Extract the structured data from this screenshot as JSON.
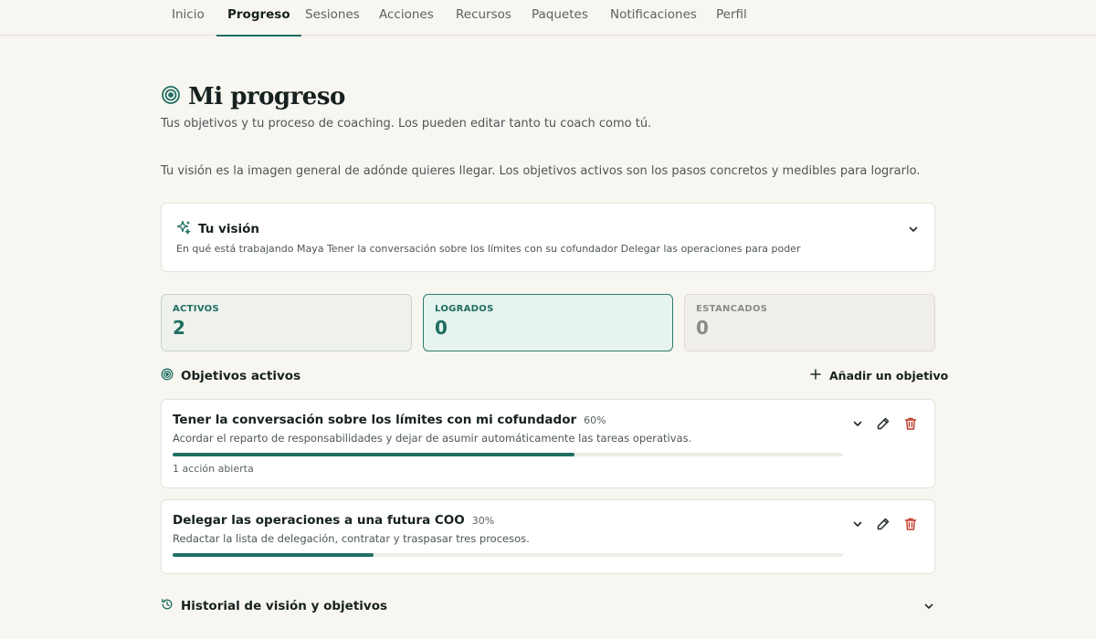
{
  "nav": {
    "tabs": [
      {
        "label": "Inicio"
      },
      {
        "label": "Progreso"
      },
      {
        "label": "Sesiones"
      },
      {
        "label": "Acciones"
      },
      {
        "label": "Recursos"
      },
      {
        "label": "Paquetes"
      },
      {
        "label": "Notificaciones"
      },
      {
        "label": "Perfil"
      }
    ],
    "active_index": 1
  },
  "header": {
    "title": "Mi progreso",
    "icon": "target-icon",
    "subtitle": "Tus objetivos y tu proceso de coaching. Los pueden editar tanto tu coach como tú.",
    "intro": "Tu visión es la imagen general de adónde quieres llegar. Los objetivos activos son los pasos concretos y medibles para lograrlo."
  },
  "vision": {
    "title": "Tu visión",
    "icon": "sparkles-icon",
    "text": "En qué está trabajando Maya Tener la conversación sobre los límites con su cofundador Delegar las operaciones para poder"
  },
  "stats": {
    "active": {
      "label": "ACTIVOS",
      "value": "2"
    },
    "achieved": {
      "label": "LOGRADOS",
      "value": "0"
    },
    "stalled": {
      "label": "ESTANCADOS",
      "value": "0"
    }
  },
  "goals_section": {
    "title": "Objetivos activos",
    "add_label": "Añadir un objetivo"
  },
  "goals": [
    {
      "name": "Tener la conversación sobre los límites con mi cofundador",
      "percent_label": "60%",
      "progress": 0.6,
      "description": "Acordar el reparto de responsabilidades y dejar de asumir automáticamente las tareas operativas.",
      "open_actions": "1 acción abierta"
    },
    {
      "name": "Delegar las operaciones a una futura COO",
      "percent_label": "30%",
      "progress": 0.3,
      "description": "Redactar la lista de delegación, contratar y traspasar tres procesos."
    }
  ],
  "history": {
    "title": "Historial de visión y objetivos",
    "icon": "history-icon"
  },
  "colors": {
    "accent": "#1f6e62",
    "danger": "#c0392b",
    "background": "#f8f6f1"
  }
}
